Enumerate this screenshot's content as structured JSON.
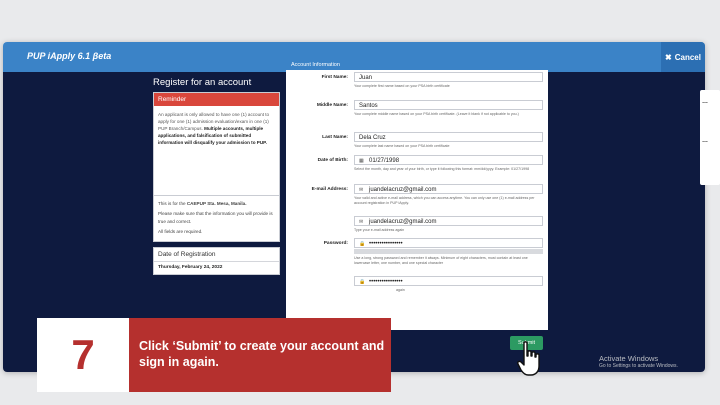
{
  "window": {
    "title": "PUP iApply 6.1 βeta",
    "cancel_label": "Cancel"
  },
  "register_title": "Register for an account",
  "reminder": {
    "heading": "Reminder",
    "text_plain": "An applicant is only allowed to have one (1) account to apply for one (1) admission evaluation/exam in one (1) PUP Branch/Campus.",
    "text_bold": "Multiple accounts, multiple applications, and falsification of submitted information will disqualify your admission to PUP."
  },
  "campus_info": {
    "line1_prefix": "This is for the",
    "line1_bold": "CAEPUP Sta. Mesa, Manila.",
    "line2": "Please make sure that the information you will provide is true and correct.",
    "line3": "All fields are required."
  },
  "date_of_registration": {
    "heading": "Date of Registration",
    "value": "Thursday, February 24, 2022"
  },
  "account_info": {
    "heading": "Account Information",
    "first_name": {
      "label": "First Name:",
      "value": "Juan",
      "help": "Your complete first name based on your PSA birth certificate"
    },
    "middle_name": {
      "label": "Middle Name:",
      "value": "Santos",
      "help": "Your complete middle name based on your PSA birth certificate. (Leave it blank if not applicable to you.)"
    },
    "last_name": {
      "label": "Last Name:",
      "value": "Dela Cruz",
      "help": "Your complete last name based on your PSA birth certificate"
    },
    "dob": {
      "label": "Date of Birth:",
      "value": "01/27/1998",
      "help": "Select the month, day and year of your birth, or type it following this format: mm/dd/yyyy. Example: 01/27/1998"
    },
    "email": {
      "label": "E-mail Address:",
      "value": "juandelacruz@gmail.com",
      "help": "Your valid and active e-mail address, which you can access anytime. You can only use one (1) e-mail address per account registration in PUP iApply."
    },
    "email_confirm": {
      "value": "juandelacruz@gmail.com",
      "help": "Type your e-mail address again"
    },
    "password": {
      "label": "Password:",
      "value": "••••••••••••••••",
      "help": "Use a long, strong password and remember it always. Minimum of eight characters, must contain at least one lowercase letter, one number, and one special character"
    },
    "password_confirm": {
      "value": "••••••••••••••••",
      "help": "again"
    }
  },
  "submit_label": "Submit",
  "watermark": {
    "line1": "Activate Windows",
    "line2": "Go to Settings to activate Windows."
  },
  "step": {
    "number": "7",
    "text": "Click ‘Submit’ to create your account and sign in again."
  },
  "edge_card": {
    "line1": "…",
    "line2": "…"
  },
  "colors": {
    "titlebar": "#3b83c7",
    "background_navy": "#0e1a3f",
    "reminder_red": "#d9473c",
    "submit_green": "#2c9a62",
    "step_red": "#b5302e"
  }
}
